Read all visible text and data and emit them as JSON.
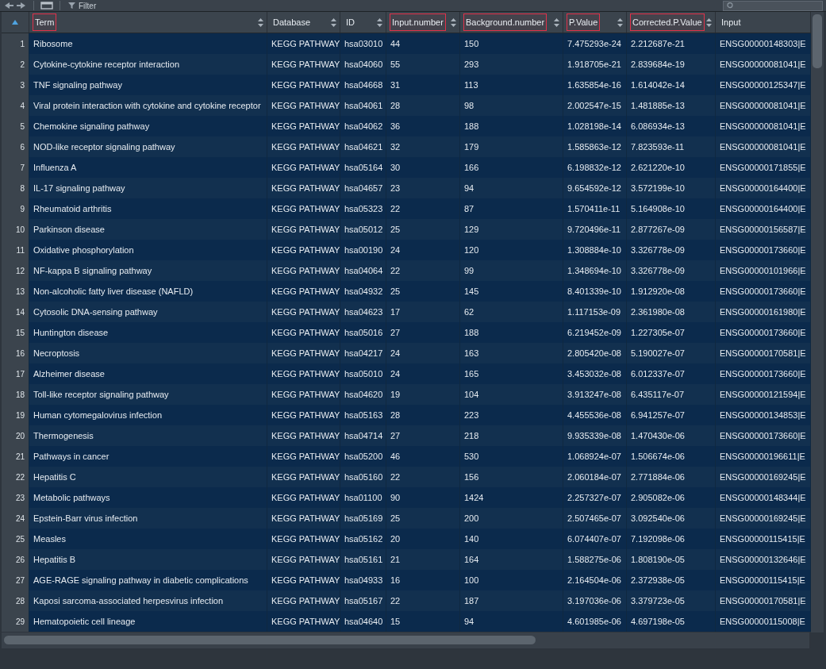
{
  "toolbar": {
    "filter_label": "Filter"
  },
  "row_number_header": {
    "sorted": true
  },
  "columns": [
    {
      "label": "Term",
      "sortable": true,
      "highlighted": true
    },
    {
      "label": "Database",
      "sortable": true,
      "highlighted": false
    },
    {
      "label": "ID",
      "sortable": true,
      "highlighted": false
    },
    {
      "label": "Input.number",
      "sortable": true,
      "highlighted": true
    },
    {
      "label": "Background.number",
      "sortable": true,
      "highlighted": true
    },
    {
      "label": "P.Value",
      "sortable": true,
      "highlighted": true
    },
    {
      "label": "Corrected.P.Value",
      "sortable": true,
      "highlighted": true
    },
    {
      "label": "Input",
      "sortable": false,
      "highlighted": false
    }
  ],
  "rows": [
    [
      "1",
      "Ribosome",
      "KEGG PATHWAY",
      "hsa03010",
      "44",
      "150",
      "7.475293e-24",
      "2.212687e-21",
      "ENSG00000148303|E"
    ],
    [
      "2",
      "Cytokine-cytokine receptor interaction",
      "KEGG PATHWAY",
      "hsa04060",
      "55",
      "293",
      "1.918705e-21",
      "2.839684e-19",
      "ENSG00000081041|E"
    ],
    [
      "3",
      "TNF signaling pathway",
      "KEGG PATHWAY",
      "hsa04668",
      "31",
      "113",
      "1.635854e-16",
      "1.614042e-14",
      "ENSG00000125347|E"
    ],
    [
      "4",
      "Viral protein interaction with cytokine and cytokine receptor",
      "KEGG PATHWAY",
      "hsa04061",
      "28",
      "98",
      "2.002547e-15",
      "1.481885e-13",
      "ENSG00000081041|E"
    ],
    [
      "5",
      "Chemokine signaling pathway",
      "KEGG PATHWAY",
      "hsa04062",
      "36",
      "188",
      "1.028198e-14",
      "6.086934e-13",
      "ENSG00000081041|E"
    ],
    [
      "6",
      "NOD-like receptor signaling pathway",
      "KEGG PATHWAY",
      "hsa04621",
      "32",
      "179",
      "1.585863e-12",
      "7.823593e-11",
      "ENSG00000081041|E"
    ],
    [
      "7",
      "Influenza A",
      "KEGG PATHWAY",
      "hsa05164",
      "30",
      "166",
      "6.198832e-12",
      "2.621220e-10",
      "ENSG00000171855|E"
    ],
    [
      "8",
      "IL-17 signaling pathway",
      "KEGG PATHWAY",
      "hsa04657",
      "23",
      "94",
      "9.654592e-12",
      "3.572199e-10",
      "ENSG00000164400|E"
    ],
    [
      "9",
      "Rheumatoid arthritis",
      "KEGG PATHWAY",
      "hsa05323",
      "22",
      "87",
      "1.570411e-11",
      "5.164908e-10",
      "ENSG00000164400|E"
    ],
    [
      "10",
      "Parkinson disease",
      "KEGG PATHWAY",
      "hsa05012",
      "25",
      "129",
      "9.720496e-11",
      "2.877267e-09",
      "ENSG00000156587|E"
    ],
    [
      "11",
      "Oxidative phosphorylation",
      "KEGG PATHWAY",
      "hsa00190",
      "24",
      "120",
      "1.308884e-10",
      "3.326778e-09",
      "ENSG00000173660|E"
    ],
    [
      "12",
      "NF-kappa B signaling pathway",
      "KEGG PATHWAY",
      "hsa04064",
      "22",
      "99",
      "1.348694e-10",
      "3.326778e-09",
      "ENSG00000101966|E"
    ],
    [
      "13",
      "Non-alcoholic fatty liver disease (NAFLD)",
      "KEGG PATHWAY",
      "hsa04932",
      "25",
      "145",
      "8.401339e-10",
      "1.912920e-08",
      "ENSG00000173660|E"
    ],
    [
      "14",
      "Cytosolic DNA-sensing pathway",
      "KEGG PATHWAY",
      "hsa04623",
      "17",
      "62",
      "1.117153e-09",
      "2.361980e-08",
      "ENSG00000161980|E"
    ],
    [
      "15",
      "Huntington disease",
      "KEGG PATHWAY",
      "hsa05016",
      "27",
      "188",
      "6.219452e-09",
      "1.227305e-07",
      "ENSG00000173660|E"
    ],
    [
      "16",
      "Necroptosis",
      "KEGG PATHWAY",
      "hsa04217",
      "24",
      "163",
      "2.805420e-08",
      "5.190027e-07",
      "ENSG00000170581|E"
    ],
    [
      "17",
      "Alzheimer disease",
      "KEGG PATHWAY",
      "hsa05010",
      "24",
      "165",
      "3.453032e-08",
      "6.012337e-07",
      "ENSG00000173660|E"
    ],
    [
      "18",
      "Toll-like receptor signaling pathway",
      "KEGG PATHWAY",
      "hsa04620",
      "19",
      "104",
      "3.913247e-08",
      "6.435117e-07",
      "ENSG00000121594|E"
    ],
    [
      "19",
      "Human cytomegalovirus infection",
      "KEGG PATHWAY",
      "hsa05163",
      "28",
      "223",
      "4.455536e-08",
      "6.941257e-07",
      "ENSG00000134853|E"
    ],
    [
      "20",
      "Thermogenesis",
      "KEGG PATHWAY",
      "hsa04714",
      "27",
      "218",
      "9.935339e-08",
      "1.470430e-06",
      "ENSG00000173660|E"
    ],
    [
      "21",
      "Pathways in cancer",
      "KEGG PATHWAY",
      "hsa05200",
      "46",
      "530",
      "1.068924e-07",
      "1.506674e-06",
      "ENSG00000196611|E"
    ],
    [
      "22",
      "Hepatitis C",
      "KEGG PATHWAY",
      "hsa05160",
      "22",
      "156",
      "2.060184e-07",
      "2.771884e-06",
      "ENSG00000169245|E"
    ],
    [
      "23",
      "Metabolic pathways",
      "KEGG PATHWAY",
      "hsa01100",
      "90",
      "1424",
      "2.257327e-07",
      "2.905082e-06",
      "ENSG00000148344|E"
    ],
    [
      "24",
      "Epstein-Barr virus infection",
      "KEGG PATHWAY",
      "hsa05169",
      "25",
      "200",
      "2.507465e-07",
      "3.092540e-06",
      "ENSG00000169245|E"
    ],
    [
      "25",
      "Measles",
      "KEGG PATHWAY",
      "hsa05162",
      "20",
      "140",
      "6.074407e-07",
      "7.192098e-06",
      "ENSG00000115415|E"
    ],
    [
      "26",
      "Hepatitis B",
      "KEGG PATHWAY",
      "hsa05161",
      "21",
      "164",
      "1.588275e-06",
      "1.808190e-05",
      "ENSG00000132646|E"
    ],
    [
      "27",
      "AGE-RAGE signaling pathway in diabetic complications",
      "KEGG PATHWAY",
      "hsa04933",
      "16",
      "100",
      "2.164504e-06",
      "2.372938e-05",
      "ENSG00000115415|E"
    ],
    [
      "28",
      "Kaposi sarcoma-associated herpesvirus infection",
      "KEGG PATHWAY",
      "hsa05167",
      "22",
      "187",
      "3.197036e-06",
      "3.379723e-05",
      "ENSG00000170581|E"
    ],
    [
      "29",
      "Hematopoietic cell lineage",
      "KEGG PATHWAY",
      "hsa04640",
      "15",
      "94",
      "4.601985e-06",
      "4.697198e-05",
      "ENSG00000115008|E"
    ]
  ]
}
